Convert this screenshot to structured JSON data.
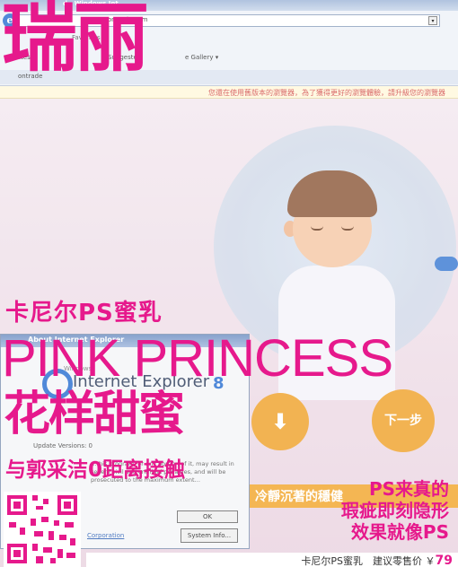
{
  "cover": {
    "masthead": "瑞丽",
    "headline_1": "卡尼尔PS蜜乳",
    "headline_2": "PINK PRINCESS",
    "headline_3": "花样甜蜜",
    "headline_4": "与郭采洁0距离接触",
    "right_1": "PS来真的",
    "right_2": "瑕疵即刻隐形",
    "right_3": "效果就像PS",
    "footer_text": "卡尼尔PS蜜乳　建议零售价 ￥",
    "footer_price": "79"
  },
  "browser": {
    "title_text": "d - Windows Int",
    "address_text": "contrade.com",
    "menu_favorites": "Favorites",
    "fav_label": "orites",
    "fav_suggested": "Suggested",
    "fav_gallery": "e Gallery ▾",
    "tab_label": "ontrade",
    "notice": "您還在使用舊版本的瀏覽器，為了獲得更好的瀏覽體驗，請升級您的瀏覽器"
  },
  "page": {
    "download_glyph": "⬇",
    "next_label": "下一步",
    "banner_text": "冷靜沉著的穩健"
  },
  "about_dialog": {
    "title": "About Internet Explorer",
    "windows_label": "Windows",
    "product": "Internet Explorer",
    "version": "8",
    "update_label": "Update Versions: 0",
    "legal": "…this program, or any portion of it, may result in severe civil and criminal penalties, and will be prosecuted to the maximum extent…",
    "ok_label": "OK",
    "corporation_link": "Corporation",
    "system_info_label": "System Info..."
  },
  "colors": {
    "brand_pink": "#e6198c",
    "orange": "#f0a32d"
  }
}
